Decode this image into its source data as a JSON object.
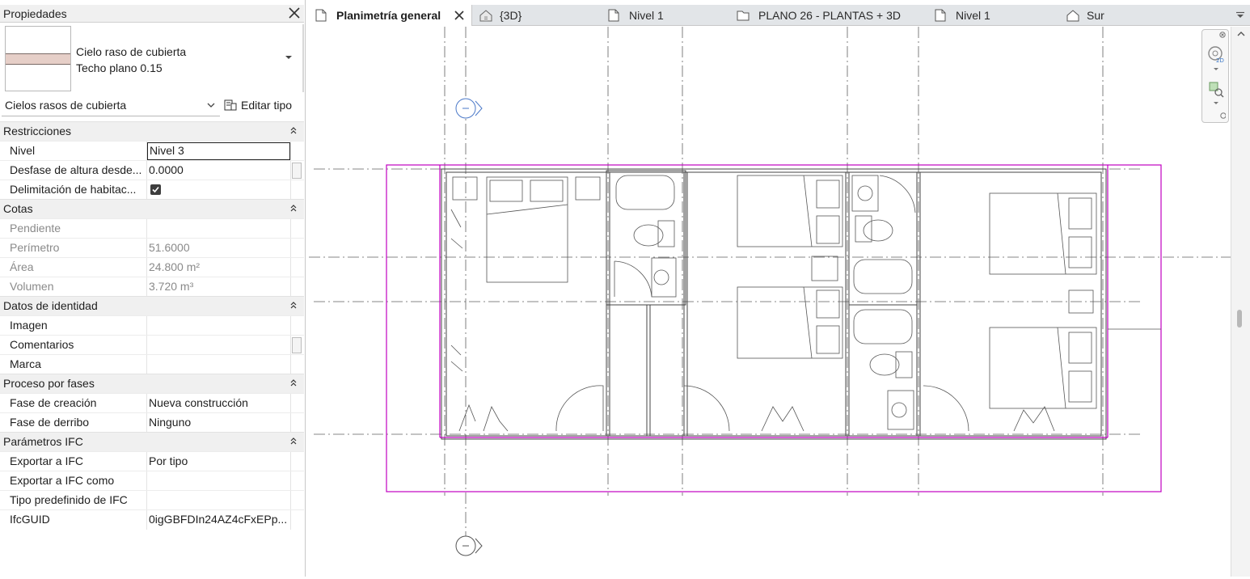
{
  "properties": {
    "title": "Propiedades",
    "type_selector": {
      "family": "Cielo raso de cubierta",
      "type": "Techo plano 0.15"
    },
    "filter_value": "Cielos rasos de cubierta",
    "edit_type_label": "Editar tipo",
    "groups": [
      {
        "label": "Restricciones",
        "rows": [
          {
            "key": "Nivel",
            "value": "Nivel 3",
            "editing": true
          },
          {
            "key": "Desfase de altura desde...",
            "value": "0.0000"
          },
          {
            "key": "Delimitación de habitac...",
            "value": "",
            "checked": true
          }
        ]
      },
      {
        "label": "Cotas",
        "rows": [
          {
            "key": "Pendiente",
            "value": "",
            "dim": true
          },
          {
            "key": "Perímetro",
            "value": "51.6000",
            "dim": true
          },
          {
            "key": "Área",
            "value": "24.800 m²",
            "dim": true
          },
          {
            "key": "Volumen",
            "value": "3.720 m³",
            "dim": true
          }
        ]
      },
      {
        "label": "Datos de identidad",
        "rows": [
          {
            "key": "Imagen",
            "value": ""
          },
          {
            "key": "Comentarios",
            "value": ""
          },
          {
            "key": "Marca",
            "value": ""
          }
        ]
      },
      {
        "label": "Proceso por fases",
        "rows": [
          {
            "key": "Fase de creación",
            "value": "Nueva construcción"
          },
          {
            "key": "Fase de derribo",
            "value": "Ninguno"
          }
        ]
      },
      {
        "label": "Parámetros IFC",
        "rows": [
          {
            "key": "Exportar a IFC",
            "value": "Por tipo"
          },
          {
            "key": "Exportar a IFC como",
            "value": ""
          },
          {
            "key": "Tipo predefinido de IFC",
            "value": ""
          },
          {
            "key": "IfcGUID",
            "value": "0igGBFDIn24AZ4cFxEPp..."
          }
        ]
      }
    ]
  },
  "tabs": [
    {
      "label": "Planimetría general",
      "icon": "floor-plan-icon",
      "active": true
    },
    {
      "label": "{3D}",
      "icon": "3d-house-icon"
    },
    {
      "label": "Nivel 1",
      "icon": "floor-plan-icon"
    },
    {
      "label": "PLANO 26 - PLANTAS + 3D",
      "icon": "sheet-icon"
    },
    {
      "label": "Nivel 1",
      "icon": "floor-plan-icon"
    },
    {
      "label": "Sur",
      "icon": "elevation-icon"
    }
  ],
  "colors": {
    "selection": "#c000c0",
    "gridline": "#555555",
    "wall": "#444444",
    "grid_head": "#4a78c8"
  }
}
